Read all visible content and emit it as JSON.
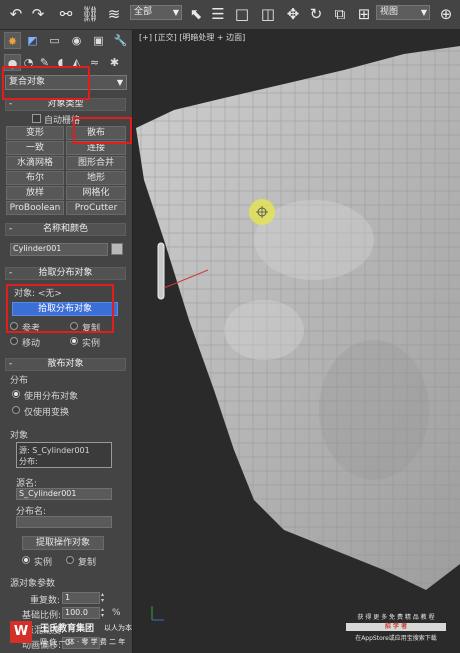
{
  "toolbar": {
    "icons": [
      "undo-icon",
      "redo-icon",
      "link-icon",
      "unlink-icon",
      "bind-space-warp-icon",
      "select-icon",
      "select-by-name-icon",
      "rect-select-icon",
      "window-crossing-icon",
      "move-icon",
      "rotate-icon",
      "scale-icon",
      "reference-coord-icon"
    ],
    "filter_value": "全部",
    "coord_value": "视图"
  },
  "command_panel": {
    "category_value": "复合对象",
    "object_type": {
      "title": "对象类型",
      "autogrid_label": "自动栅格",
      "buttons": [
        "变形",
        "散布",
        "一致",
        "连接",
        "水滴网格",
        "图形合并",
        "布尔",
        "地形",
        "放样",
        "网格化",
        "ProBoolean",
        "ProCutter"
      ]
    },
    "name_color": {
      "title": "名称和颜色",
      "name_value": "Cylinder001"
    },
    "pick_distribution": {
      "title": "拾取分布对象",
      "object_label": "对象: <无>",
      "pick_button": "拾取分布对象",
      "radio_reference": "参考",
      "radio_copy": "复制",
      "radio_move": "移动",
      "radio_instance": "实例"
    },
    "scatter_objects": {
      "title": "散布对象",
      "distribution_label": "分布",
      "use_distribution": "使用分布对象",
      "use_transform_only": "仅使用变换",
      "objects_label": "对象",
      "list_items": [
        "源: S_Cylinder001",
        "分布:"
      ],
      "source_name_label": "源名:",
      "source_name_value": "S_Cylinder001",
      "distribution_name_label": "分布名:",
      "distribution_name_value": "",
      "extract_button": "提取操作对象",
      "radio_instance": "实例",
      "radio_copy": "复制"
    },
    "source_params": {
      "title": "源对象参数",
      "duplicates_label": "重复数:",
      "duplicates_value": "1",
      "base_scale_label": "基础比例:",
      "base_scale_value": "100.0",
      "base_scale_unit": "%",
      "vertex_chaos_label": "顶点混乱度:",
      "anim_offset_label": "动画偏移:",
      "anim_offset_value": "0"
    }
  },
  "viewport": {
    "label": "[+] [正交] [明暗处理 + 边面]"
  },
  "watermark": {
    "brand": "王氏教育集团",
    "slogan": "以人为本",
    "sub": "四 位 一 体 · 零 学 费 二 年",
    "right_line1": "获 得 更 多 免 费 精 品 教 程",
    "right_bar": "招 学 者",
    "right_line2": "在AppStore或应用宝搜索下载",
    "logo_letter": "W"
  },
  "colors": {
    "highlight_red": "#e01e1e",
    "pick_button_blue": "#3c6fd6",
    "gizmo_yellow": "#e8e84a"
  }
}
